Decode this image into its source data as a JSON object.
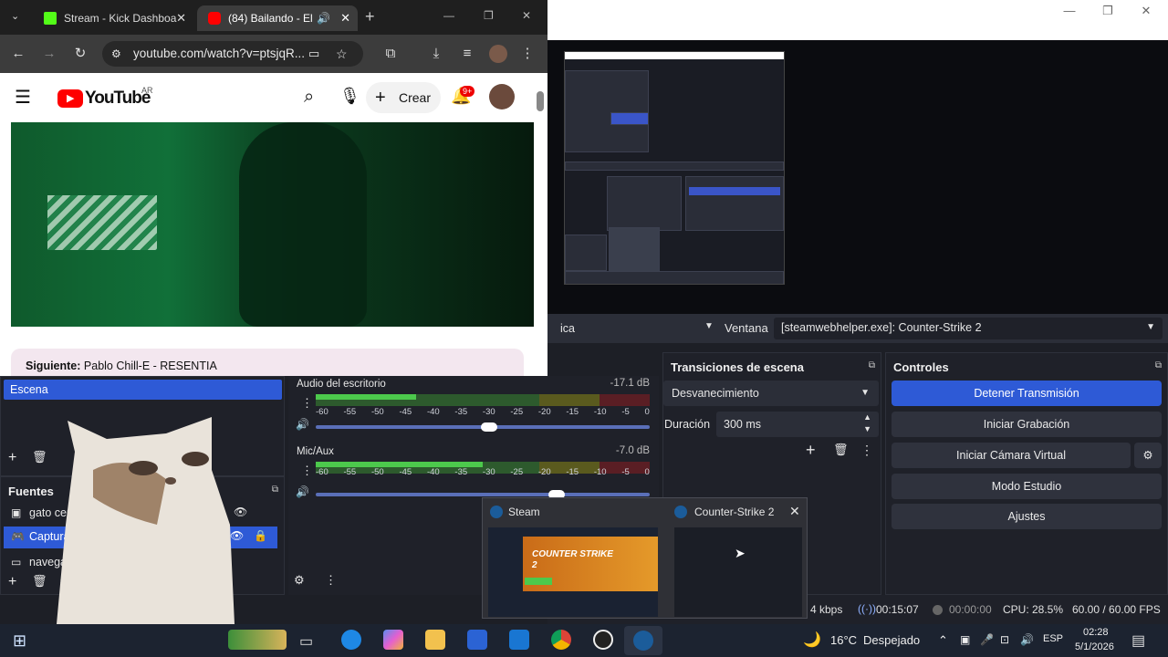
{
  "browser": {
    "tabs": [
      {
        "title": "Stream - Kick Dashboa",
        "icon": "kick-icon",
        "color": "#53fc18"
      },
      {
        "title": "(84) Bailando - El",
        "icon": "youtube-icon",
        "color": "#ff0000"
      }
    ],
    "url": "youtube.com/watch?v=ptsjqR...",
    "youtube": {
      "logo": "YouTube",
      "region": "AR",
      "create_label": "Crear",
      "notifications": "9+",
      "next_label": "Siguiente:",
      "next_title": "Pablo Chill-E - RESENTIA"
    }
  },
  "obs": {
    "source_type_fragment": "ica",
    "window_label": "Ventana",
    "window_value": "[steamwebhelper.exe]: Counter-Strike 2",
    "scenes": {
      "title": "Escena",
      "selected": "Escena"
    },
    "sources": {
      "title": "Fuentes",
      "items": [
        "gato cerrado",
        "Captura de ju",
        "navegador"
      ]
    },
    "mixer": {
      "channels": [
        {
          "name": "Audio del escritorio",
          "db": "-17.1 dB",
          "level": 0.3,
          "volume": 0.52
        },
        {
          "name": "Mic/Aux",
          "db": "-7.0 dB",
          "level": 0.5,
          "volume": 0.72
        }
      ],
      "scale": [
        "-60",
        "-55",
        "-50",
        "-45",
        "-40",
        "-35",
        "-30",
        "-25",
        "-20",
        "-15",
        "-10",
        "-5",
        "0"
      ]
    },
    "transitions": {
      "title": "Transiciones de escena",
      "type": "Desvanecimiento",
      "duration_label": "Duración",
      "duration_value": "300 ms"
    },
    "controls": {
      "title": "Controles",
      "buttons": [
        "Detener Transmisión",
        "Iniciar Grabación",
        "Iniciar Cámara Virtual",
        "Modo Estudio",
        "Ajustes"
      ]
    },
    "status": {
      "bitrate": "4 kbps",
      "stream_time": "00:15:07",
      "record_time": "00:00:00",
      "cpu": "CPU: 28.5%",
      "fps": "60.00 / 60.00 FPS"
    }
  },
  "preview_popup": {
    "items": [
      {
        "title": "Steam",
        "game_title": "COUNTER STRIKE 2"
      },
      {
        "title": "Counter-Strike 2"
      }
    ]
  },
  "taskbar": {
    "weather_temp": "16°C",
    "weather_text": "Despejado",
    "language": "ESP",
    "time": "02:28",
    "date": "5/1/2026"
  },
  "colors": {
    "obs_accent": "#2e5ad6",
    "youtube_red": "#ff0000",
    "meter_green": "#4cc94c"
  }
}
